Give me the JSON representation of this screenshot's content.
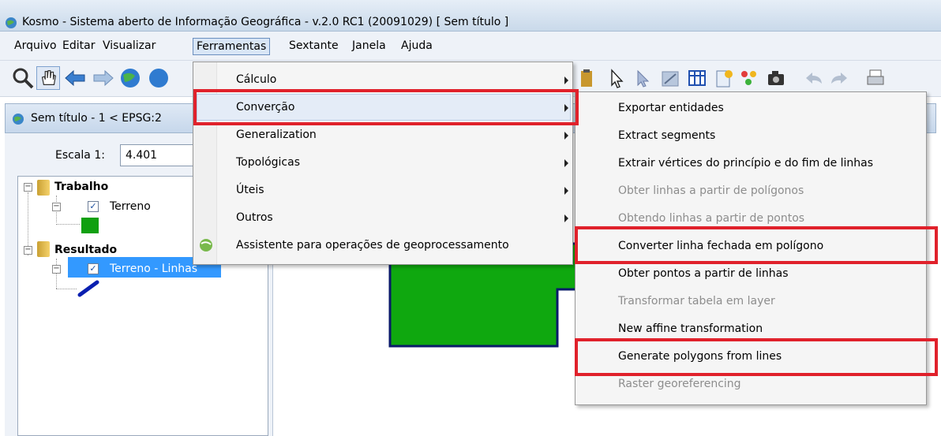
{
  "window": {
    "title": "Kosmo - Sistema aberto de Informação Geográfica - v.2.0 RC1 (20091029)  [ Sem título ]"
  },
  "menubar": {
    "items": [
      "Arquivo",
      "Editar",
      "Visualizar",
      "Ferramentas",
      "Sextante",
      "Janela",
      "Ajuda"
    ],
    "active": "Ferramentas"
  },
  "map_window": {
    "title": "Sem título - 1 < EPSG:2",
    "scale_label": "Escala 1:",
    "scale_value": "4.401"
  },
  "layer_tree": {
    "groups": [
      {
        "name": "Trabalho",
        "layers": [
          {
            "name": "Terreno",
            "checked": true,
            "symbol_color": "#10a010"
          }
        ]
      },
      {
        "name": "Resultado",
        "layers": [
          {
            "name": "Terreno - Linhas",
            "checked": true,
            "symbol_color": "#0a1fb0",
            "selected": true
          }
        ]
      }
    ]
  },
  "ferramentas_menu": {
    "items": [
      {
        "label": "Cálculo",
        "submenu": true
      },
      {
        "label": "Converção",
        "submenu": true,
        "highlighted": true
      },
      {
        "label": "Generalization",
        "submenu": true
      },
      {
        "label": "Topológicas",
        "submenu": true
      },
      {
        "label": "Úteis",
        "submenu": true
      },
      {
        "label": "Outros",
        "submenu": true
      },
      {
        "label": "Assistente para operações de geoprocessamento",
        "submenu": false,
        "icon": "globe-icon"
      }
    ]
  },
  "convercao_submenu": {
    "items": [
      {
        "label": "Exportar entidades",
        "enabled": true
      },
      {
        "label": "Extract segments",
        "enabled": true
      },
      {
        "label": "Extrair vértices do princípio e do fim de linhas",
        "enabled": true
      },
      {
        "label": "Obter linhas a partir de polígonos",
        "enabled": false
      },
      {
        "label": "Obtendo linhas a partir de pontos",
        "enabled": false
      },
      {
        "label": "Converter linha fechada em polígono",
        "enabled": true,
        "highlighted": true
      },
      {
        "label": "Obter pontos a partir de linhas",
        "enabled": true
      },
      {
        "label": "Transformar tabela em layer",
        "enabled": false
      },
      {
        "label": "New affine transformation",
        "enabled": true
      },
      {
        "label": "Generate polygons from lines",
        "enabled": true,
        "highlighted": true
      },
      {
        "label": "Raster georeferencing",
        "enabled": false
      }
    ]
  },
  "colors": {
    "highlight_box": "#e0212b",
    "polygon_fill": "#0fa80f",
    "polygon_stroke": "#0a1a6a",
    "selection": "#3399ff"
  }
}
